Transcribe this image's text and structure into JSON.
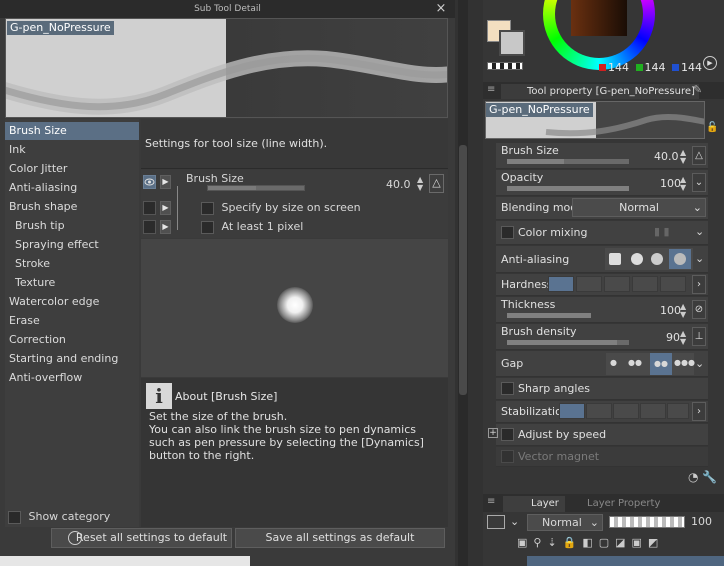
{
  "dialog": {
    "title": "Sub Tool Detail",
    "close_glyph": "×",
    "preview_name": "G-pen_NoPressure",
    "categories": [
      {
        "label": "Brush Size",
        "selected": true,
        "sub": false
      },
      {
        "label": "Ink",
        "selected": false,
        "sub": false
      },
      {
        "label": "Color Jitter",
        "selected": false,
        "sub": false
      },
      {
        "label": "Anti-aliasing",
        "selected": false,
        "sub": false
      },
      {
        "label": "Brush shape",
        "selected": false,
        "sub": false
      },
      {
        "label": "Brush tip",
        "selected": false,
        "sub": true
      },
      {
        "label": "Spraying effect",
        "selected": false,
        "sub": true
      },
      {
        "label": "Stroke",
        "selected": false,
        "sub": true
      },
      {
        "label": "Texture",
        "selected": false,
        "sub": true
      },
      {
        "label": "Watercolor edge",
        "selected": false,
        "sub": false
      },
      {
        "label": "Erase",
        "selected": false,
        "sub": false
      },
      {
        "label": "Correction",
        "selected": false,
        "sub": false
      },
      {
        "label": "Starting and ending",
        "selected": false,
        "sub": false
      },
      {
        "label": "Anti-overflow",
        "selected": false,
        "sub": false
      }
    ],
    "show_category_label": "Show category",
    "settings_desc": "Settings for tool size (line width).",
    "brush_size": {
      "label": "Brush Size",
      "value": "40.0",
      "fill": 0.5
    },
    "options": {
      "specify_by_size": "Specify by size on screen",
      "at_least_1px": "At least 1 pixel"
    },
    "about": {
      "icon": "i",
      "title": "About [Brush Size]",
      "line1": "Set the size of the brush.",
      "line2": "You can also link the brush size to pen dynamics such as pen pressure by selecting the [Dynamics] button to the right."
    },
    "buttons": {
      "reset": "Reset all settings to default",
      "save": "Save all settings as default"
    }
  },
  "color": {
    "fg": "#f3dfc0",
    "bg": "#c8c8c8",
    "r": "144",
    "g": "144",
    "b": "144",
    "r_color": "#d02020",
    "g_color": "#20b020",
    "b_color": "#2050d0"
  },
  "tool_property": {
    "tab_title": "Tool property [G-pen_NoPressure]",
    "preview_name": "G-pen_NoPressure",
    "rows": {
      "brush_size": {
        "label": "Brush Size",
        "value": "40.0",
        "fill": 0.47
      },
      "opacity": {
        "label": "Opacity",
        "value": "100",
        "fill": 1.0
      },
      "blending": {
        "label": "Blending mode",
        "value": "Normal"
      },
      "color_mixing": {
        "label": "Color mixing"
      },
      "anti_aliasing": {
        "label": "Anti-aliasing"
      },
      "hardness": {
        "label": "Hardness"
      },
      "thickness": {
        "label": "Thickness",
        "value": "100",
        "fill": 1.0
      },
      "brush_density": {
        "label": "Brush density",
        "value": "90",
        "fill": 0.9
      },
      "gap": {
        "label": "Gap"
      },
      "sharp_angles": {
        "label": "Sharp angles"
      },
      "stabilization": {
        "label": "Stabilization"
      },
      "adjust_by_speed": {
        "label": "Adjust by speed"
      },
      "vector_magnet": {
        "label": "Vector magnet"
      }
    }
  },
  "layer": {
    "tab_layer": "Layer",
    "tab_layer_property": "Layer Property",
    "blend_mode": "Normal",
    "opacity": "100"
  }
}
